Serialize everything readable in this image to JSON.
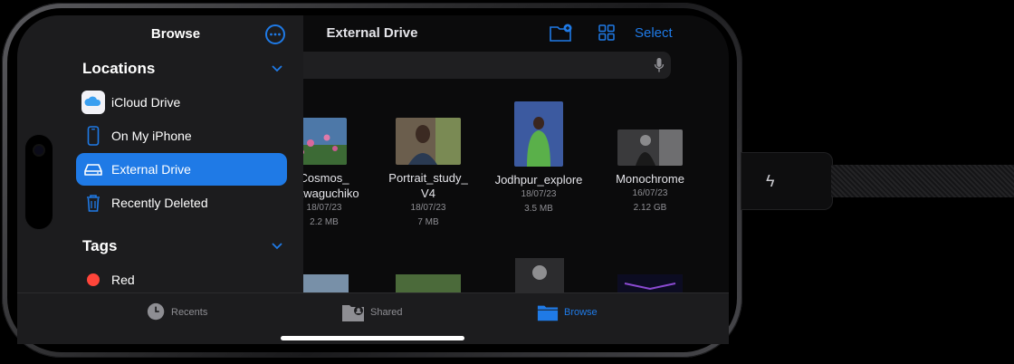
{
  "main": {
    "title": "External Drive",
    "select_label": "Select",
    "files": [
      {
        "name_line1": "Cosmos_",
        "name_line2": "Kawaguchiko",
        "date": "18/07/23",
        "size": "2.2 MB"
      },
      {
        "name_line1": "Portrait_study_",
        "name_line2": "V4",
        "date": "18/07/23",
        "size": "7 MB"
      },
      {
        "name_line1": "Jodhpur_explore",
        "name_line2": "",
        "date": "18/07/23",
        "size": "3.5 MB"
      },
      {
        "name_line1": "Monochrome",
        "name_line2": "",
        "date": "16/07/23",
        "size": "2.12 GB"
      }
    ]
  },
  "sidebar": {
    "title": "Browse",
    "locations_header": "Locations",
    "tags_header": "Tags",
    "locations": [
      {
        "label": "iCloud Drive",
        "icon": "icloud-icon"
      },
      {
        "label": "On My iPhone",
        "icon": "iphone-icon"
      },
      {
        "label": "External Drive",
        "icon": "external-drive-icon",
        "selected": true
      },
      {
        "label": "Recently Deleted",
        "icon": "trash-icon"
      }
    ],
    "tags": [
      {
        "label": "Red",
        "color": "#ff453a"
      }
    ]
  },
  "tabbar": {
    "tabs": [
      {
        "label": "Recents",
        "icon": "clock-icon"
      },
      {
        "label": "Shared",
        "icon": "shared-folder-icon"
      },
      {
        "label": "Browse",
        "icon": "folder-icon",
        "selected": true
      }
    ]
  },
  "colors": {
    "accent": "#1f7ae6",
    "tag_red": "#ff453a"
  }
}
